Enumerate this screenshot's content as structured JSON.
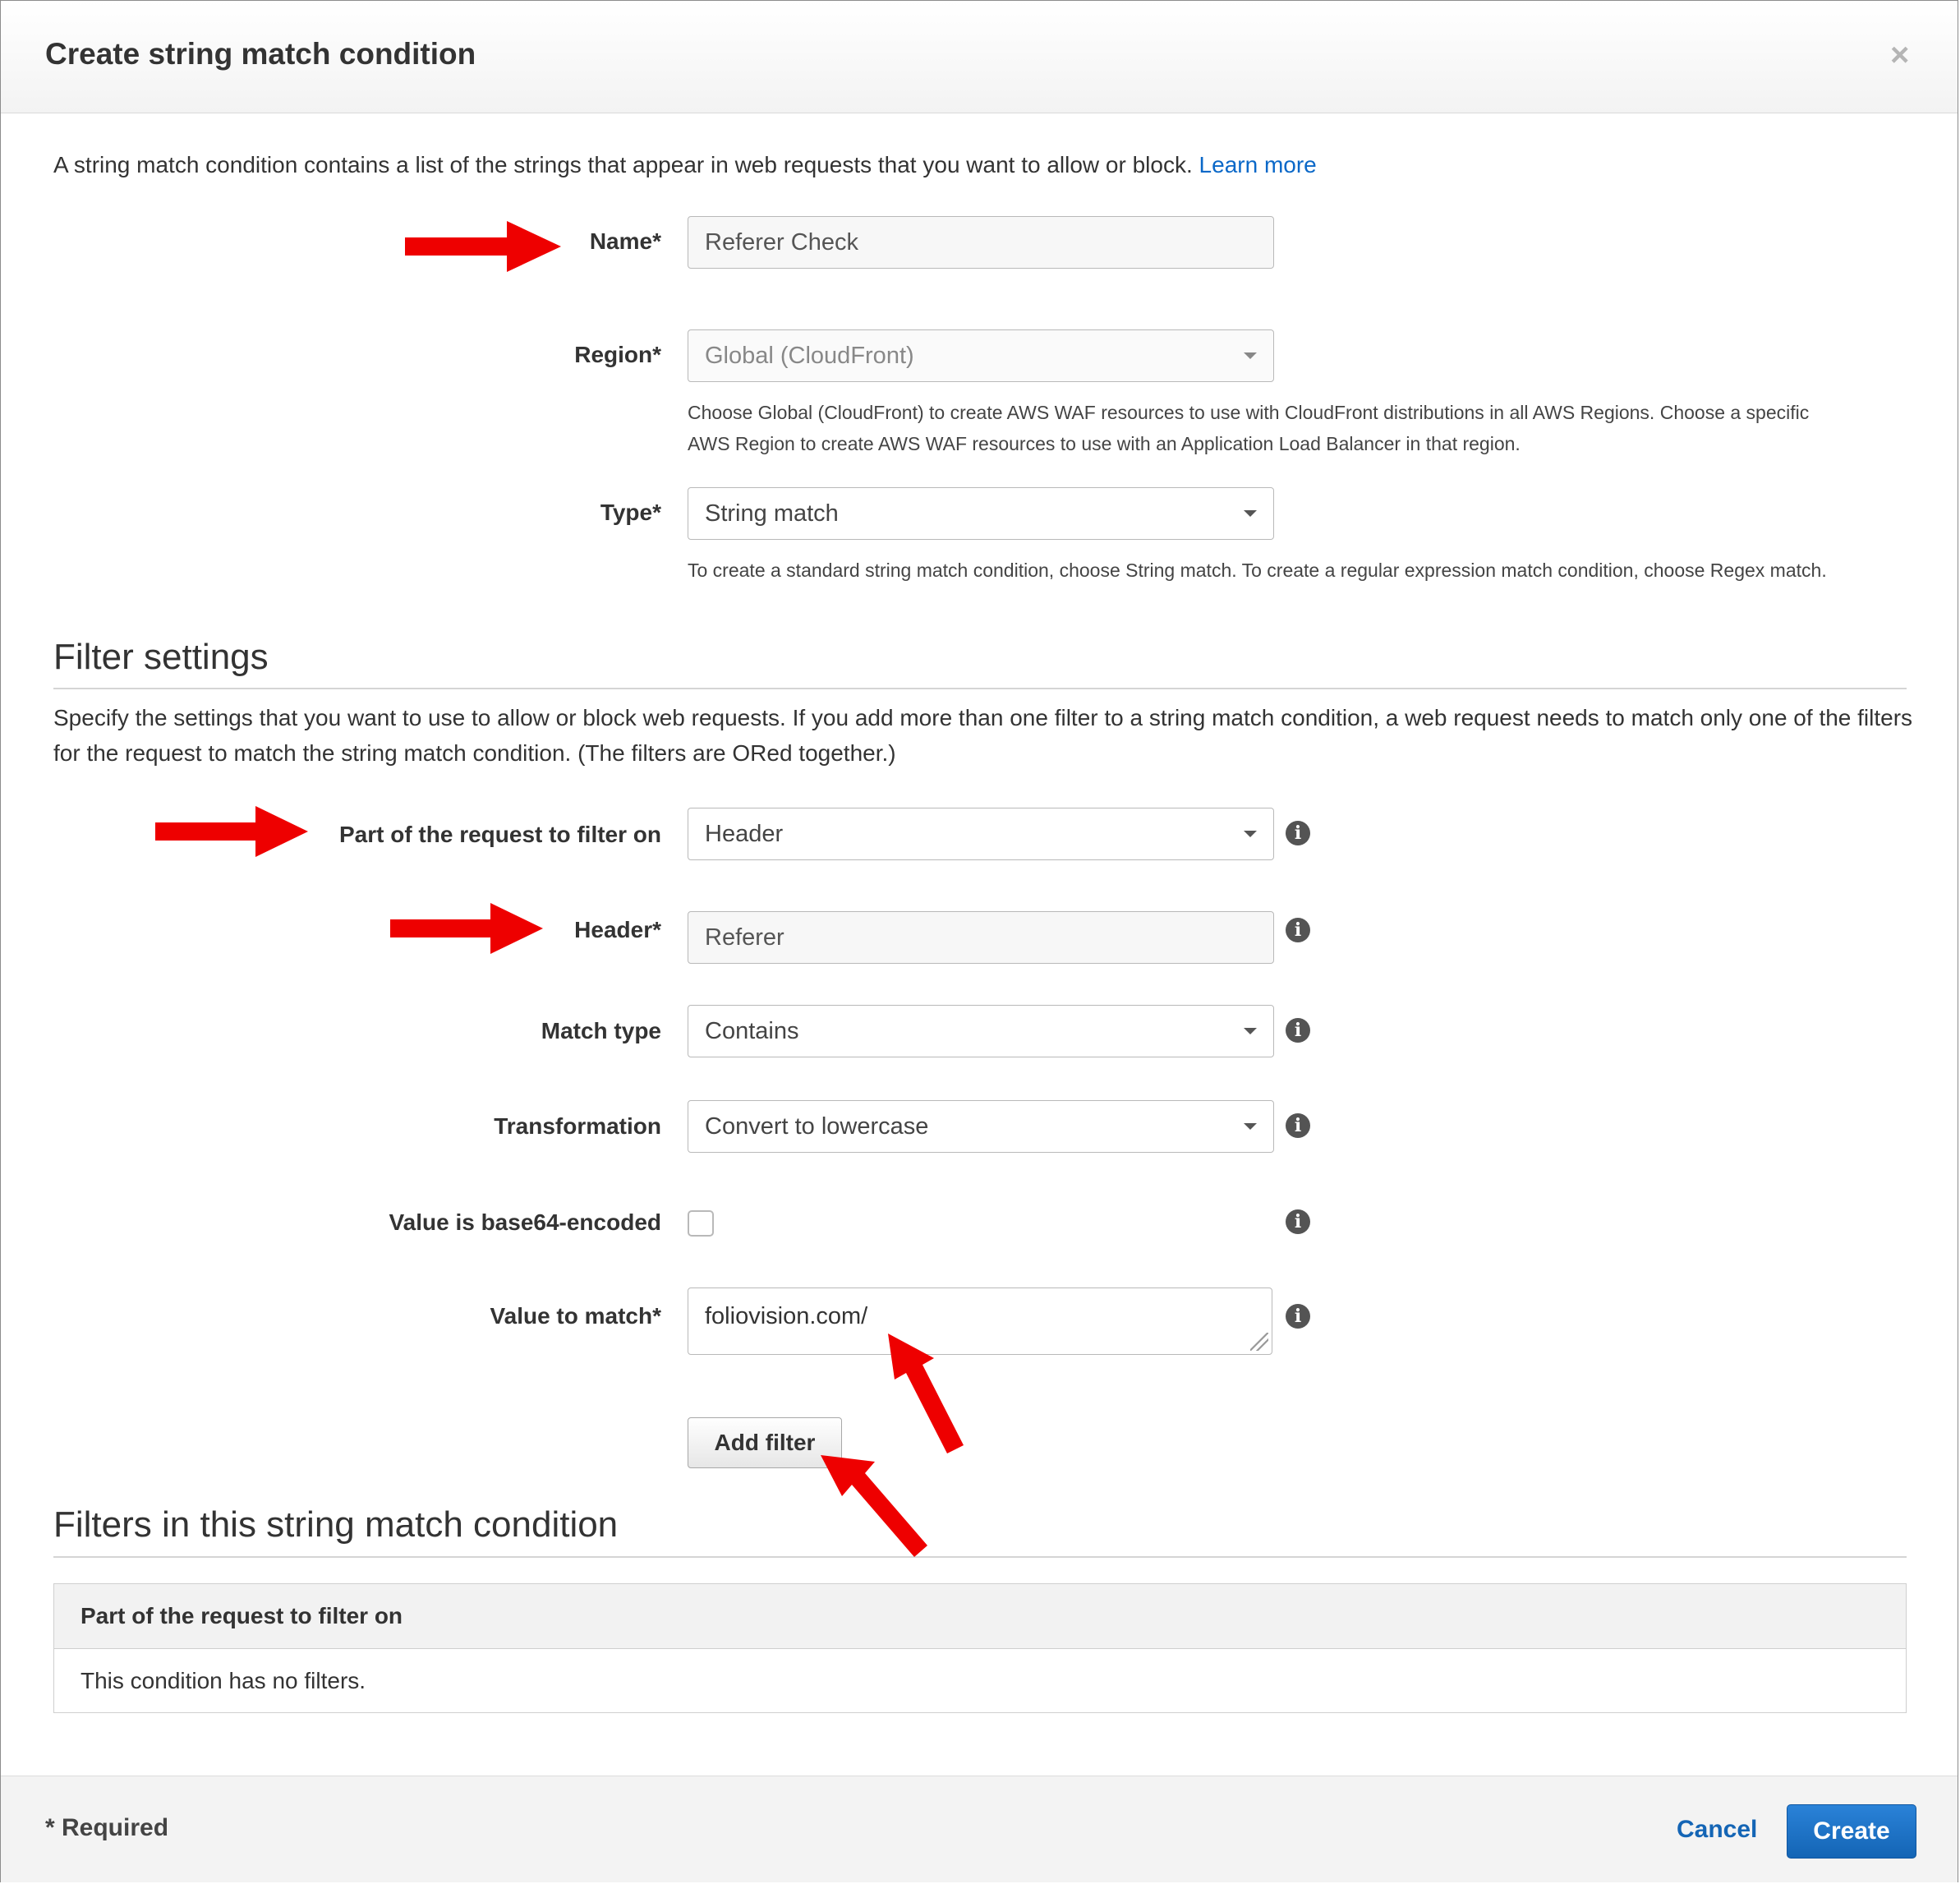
{
  "dialog": {
    "title": "Create string match condition",
    "close": "×",
    "intro_text": "A string match condition contains a list of the strings that appear in web requests that you want to allow or block.",
    "learn_more": "Learn more"
  },
  "form": {
    "name_label": "Name*",
    "name_value": "Referer Check",
    "region_label": "Region*",
    "region_value": "Global (CloudFront)",
    "region_help": "Choose Global (CloudFront) to create AWS WAF resources to use with CloudFront distributions in all AWS Regions. Choose a specific AWS Region to create AWS WAF resources to use with an Application Load Balancer in that region.",
    "type_label": "Type*",
    "type_value": "String match",
    "type_help": "To create a standard string match condition, choose String match. To create a regular expression match condition, choose Regex match."
  },
  "filter_settings": {
    "title": "Filter settings",
    "description": "Specify the settings that you want to use to allow or block web requests. If you add more than one filter to a string match condition, a web request needs to match only one of the filters for the request to match the string match condition. (The filters are ORed together.)",
    "part_label": "Part of the request to filter on",
    "part_value": "Header",
    "header_label": "Header*",
    "header_value": "Referer",
    "match_type_label": "Match type",
    "match_type_value": "Contains",
    "transformation_label": "Transformation",
    "transformation_value": "Convert to lowercase",
    "base64_label": "Value is base64-encoded",
    "value_label": "Value to match*",
    "value_value": "foliovision.com/",
    "add_filter": "Add filter",
    "info_icon": "i"
  },
  "filters_table": {
    "title": "Filters in this string match condition",
    "column_header": "Part of the request to filter on",
    "empty_text": "This condition has no filters."
  },
  "footer": {
    "required_note": "* Required",
    "cancel": "Cancel",
    "create": "Create"
  },
  "colors": {
    "link": "#0a68c8",
    "primary_button": "#1465b5",
    "annotation_arrow": "#ee0000"
  },
  "annotations": {
    "arrow_icon": "red-arrow-icon"
  }
}
